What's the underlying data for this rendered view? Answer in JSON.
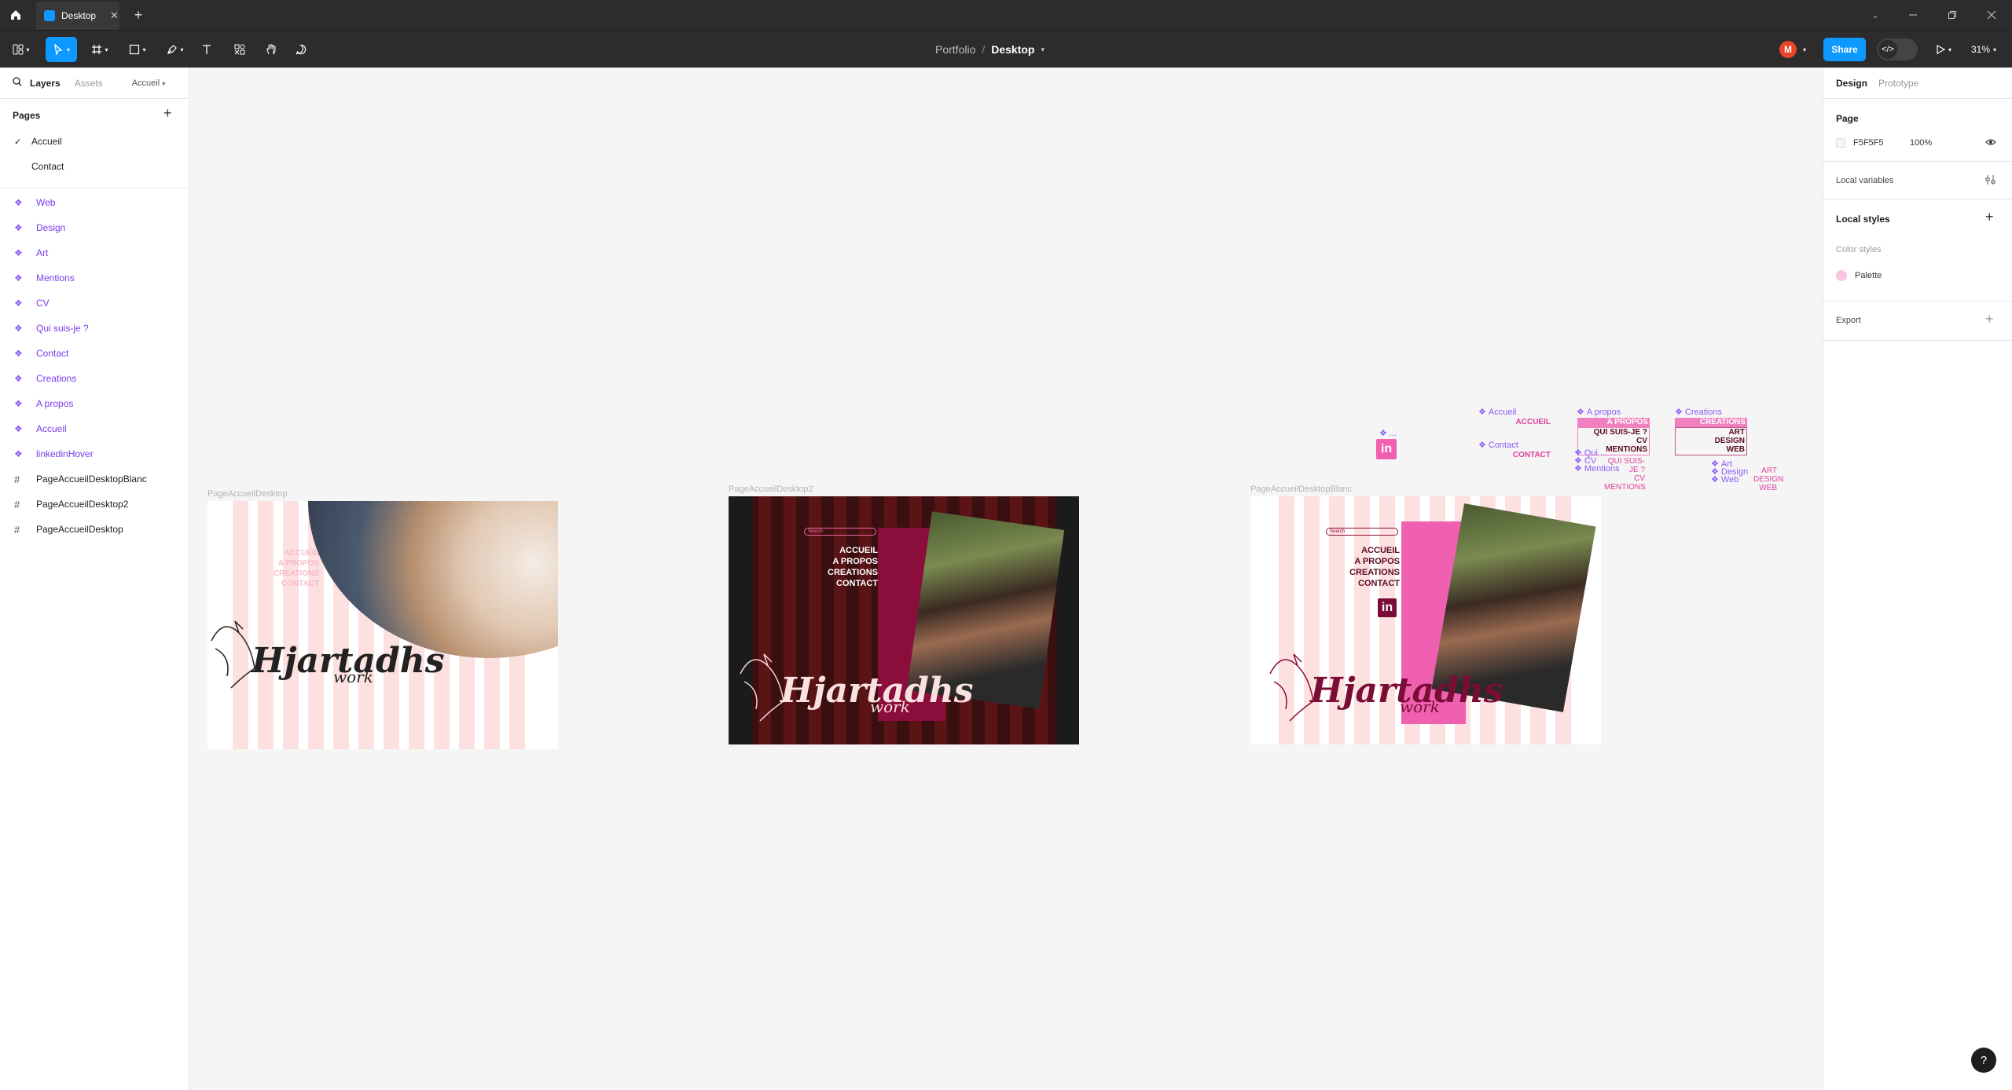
{
  "titlebar": {
    "tab_title": "Desktop",
    "add_tab": "+"
  },
  "toolbar": {
    "project": "Portfolio",
    "separator": "/",
    "file_name": "Desktop",
    "avatar_initial": "M",
    "share_label": "Share",
    "zoom": "31%"
  },
  "left_panel": {
    "tab_layers": "Layers",
    "tab_assets": "Assets",
    "current_page": "Accueil",
    "pages_title": "Pages",
    "pages": [
      "Accueil",
      "Contact"
    ],
    "layers": [
      {
        "name": "Web",
        "kind": "component"
      },
      {
        "name": "Design",
        "kind": "component"
      },
      {
        "name": "Art",
        "kind": "component"
      },
      {
        "name": "Mentions",
        "kind": "component"
      },
      {
        "name": "CV",
        "kind": "component"
      },
      {
        "name": "Qui suis-je ?",
        "kind": "component"
      },
      {
        "name": "Contact",
        "kind": "component"
      },
      {
        "name": "Creations",
        "kind": "component"
      },
      {
        "name": "A propos",
        "kind": "component"
      },
      {
        "name": "Accueil",
        "kind": "component"
      },
      {
        "name": "linkedinHover",
        "kind": "component"
      },
      {
        "name": "PageAccueilDesktopBlanc",
        "kind": "frame"
      },
      {
        "name": "PageAccueilDesktop2",
        "kind": "frame"
      },
      {
        "name": "PageAccueilDesktop",
        "kind": "frame"
      }
    ]
  },
  "right_panel": {
    "tab_design": "Design",
    "tab_prototype": "Prototype",
    "page_title": "Page",
    "page_color": "F5F5F5",
    "page_opacity": "100%",
    "local_variables": "Local variables",
    "local_styles": "Local styles",
    "color_styles": "Color styles",
    "palette": "Palette",
    "export": "Export"
  },
  "canvas": {
    "frame1": {
      "title": "PageAccueilDesktop",
      "menu": [
        "ACCUEIL",
        "A PROPOS",
        "CREATIONS",
        "CONTACT"
      ],
      "logo": "Hjartadhs",
      "logo_sub": "work"
    },
    "frame2": {
      "title": "PageAccueilDesktop2",
      "search": "Search",
      "menu": [
        "ACCUEIL",
        "A PROPOS",
        "CREATIONS",
        "CONTACT"
      ],
      "logo": "Hjartadhs",
      "logo_sub": "work"
    },
    "frame3": {
      "title": "PageAccueilDesktopBlanc",
      "search": "Search",
      "menu": [
        "ACCUEIL",
        "A PROPOS",
        "CREATIONS",
        "CONTACT"
      ],
      "logo": "Hjartadhs",
      "logo_sub": "work",
      "linkedin": "in"
    },
    "components": {
      "accueil": {
        "label": "Accueil",
        "variant": "ACCUEIL"
      },
      "contact": {
        "label": "Contact",
        "variant": "CONTACT"
      },
      "apropos": {
        "label": "A propos",
        "variant": "A PROPOS"
      },
      "apropos_menu": [
        "QUI SUIS-JE ?",
        "CV",
        "MENTIONS"
      ],
      "apropos_sub": [
        "Qui ...",
        "CV",
        "Mentions"
      ],
      "apropos_sub_variants": [
        "QUI SUIS-JE ?",
        "CV",
        "MENTIONS"
      ],
      "creations": {
        "label": "Creations",
        "variant": "CREATIONS"
      },
      "creations_menu": [
        "ART",
        "DESIGN",
        "WEB"
      ],
      "creations_sub": [
        "Art",
        "Design",
        "Web"
      ],
      "creations_sub_variants": [
        "ART",
        "DESIGN",
        "WEB"
      ],
      "linkedin_label": "...",
      "linkedin": "in"
    }
  },
  "colors": {
    "accent": "#0d99ff",
    "component": "#8b5cf6",
    "pink": "#e040a0",
    "dark_red": "#5a1415"
  }
}
